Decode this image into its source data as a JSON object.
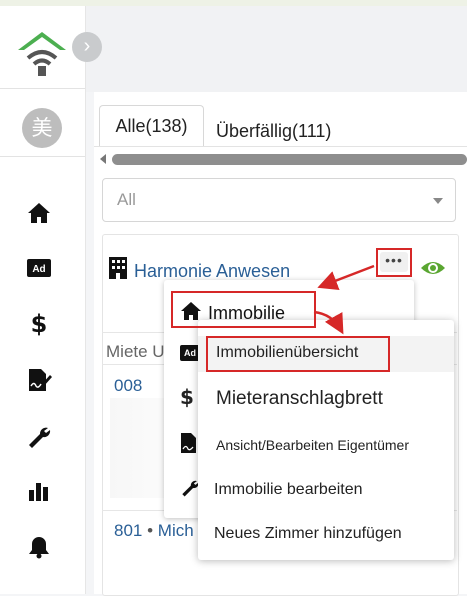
{
  "sidebar": {
    "logo_icon": "house-wifi-logo",
    "collapse_icon": "chevron-right-icon",
    "avatar_text": "美",
    "nav_icons": [
      "home-icon",
      "ad-icon",
      "dollar-icon",
      "signature-doc-icon",
      "wrench-icon",
      "bar-chart-icon",
      "bell-icon"
    ]
  },
  "tabs": [
    {
      "label": "Alle(138)"
    },
    {
      "label": "Überfällig(111)"
    }
  ],
  "filter": {
    "value": "All"
  },
  "property": {
    "name": "Harmonie Anwesen",
    "more_label": "•••",
    "eye_color": "#5aa631"
  },
  "list": {
    "column_label": "Miete U",
    "unit1": "008",
    "unit2_number": "801",
    "unit2_sep": "•",
    "unit2_tenant": "Mich"
  },
  "menu": {
    "title": "Immobilie",
    "items": [
      "Ad",
      "$",
      "doc",
      "wrench"
    ]
  },
  "submenu": {
    "items": [
      "Immobilienübersicht",
      "Mieteranschlagbrett",
      "Ansicht/Bearbeiten Eigentümer",
      "Immobilie bearbeiten",
      "Neues Zimmer hinzufügen"
    ]
  },
  "colors": {
    "annotation": "#d62828",
    "link": "#2a5f96",
    "accent": "#5aa631"
  }
}
